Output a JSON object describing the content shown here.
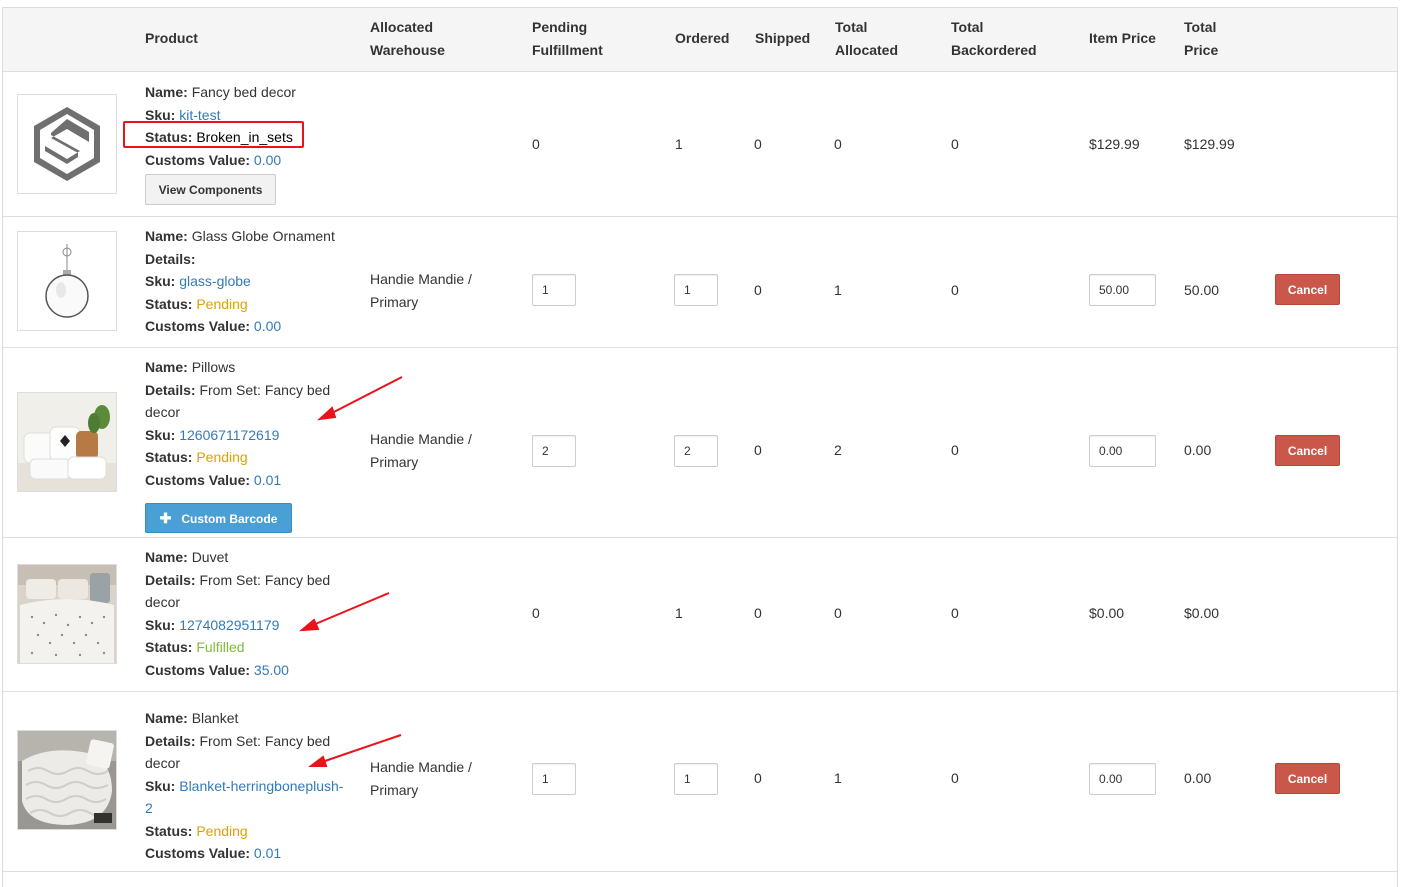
{
  "colors": {
    "link": "#337ab7",
    "pending": "#e0a000",
    "fulfilled": "#7cbb3a",
    "cancel_button": "#c9574a",
    "barcode_button": "#4a9fd5",
    "annotation_red": "#e8131b"
  },
  "headers": {
    "product": "Product",
    "warehouse_1": "Allocated",
    "warehouse_2": "Warehouse",
    "pending_1": "Pending",
    "pending_2": "Fulfillment",
    "ordered": "Ordered",
    "shipped": "Shipped",
    "total_allocated_1": "Total",
    "total_allocated_2": "Allocated",
    "total_backordered_1": "Total",
    "total_backordered_2": "Backordered",
    "item_price": "Item Price",
    "total_price_1": "Total",
    "total_price_2": "Price"
  },
  "labels": {
    "name": "Name:",
    "details": "Details:",
    "sku": "Sku:",
    "status": "Status:",
    "customs_value": "Customs Value:"
  },
  "rows": [
    {
      "name": "Fancy bed decor",
      "sku": "kit-test",
      "status": "Broken_in_sets",
      "customs_value": "0.00",
      "view_components": "View Components",
      "pending": "0",
      "ordered": "1",
      "shipped": "0",
      "total_allocated": "0",
      "total_backordered": "0",
      "item_price": "$129.99",
      "total_price": "$129.99",
      "thumb_icon": "logo-s-icon"
    },
    {
      "name": "Glass Globe Ornament",
      "details": "",
      "sku": "glass-globe",
      "status": "Pending",
      "customs_value": "0.00",
      "warehouse_1": "Handie Mandie /",
      "warehouse_2": "Primary",
      "pending": "1",
      "ordered": "1",
      "shipped": "0",
      "total_allocated": "1",
      "total_backordered": "0",
      "item_price": "50.00",
      "total_price": "50.00",
      "cancel": "Cancel",
      "thumb_icon": "ornament-icon"
    },
    {
      "name": "Pillows",
      "details_1": "From Set: Fancy bed",
      "details_2": "decor",
      "sku": "1260671172619",
      "status": "Pending",
      "customs_value": "0.01",
      "custom_barcode": "Custom Barcode",
      "warehouse_1": "Handie Mandie /",
      "warehouse_2": "Primary",
      "pending": "2",
      "ordered": "2",
      "shipped": "0",
      "total_allocated": "2",
      "total_backordered": "0",
      "item_price": "0.00",
      "total_price": "0.00",
      "cancel": "Cancel",
      "thumb_icon": "pillows-photo-icon"
    },
    {
      "name": "Duvet",
      "details_1": "From Set: Fancy bed",
      "details_2": "decor",
      "sku": "1274082951179",
      "status": "Fulfilled",
      "customs_value": "35.00",
      "pending": "0",
      "ordered": "1",
      "shipped": "0",
      "total_allocated": "0",
      "total_backordered": "0",
      "item_price": "$0.00",
      "total_price": "$0.00",
      "thumb_icon": "duvet-photo-icon"
    },
    {
      "name": "Blanket",
      "details_1": "From Set: Fancy bed",
      "details_2": "decor",
      "sku_1": "Blanket-herringboneplush-",
      "sku_2": "2",
      "status": "Pending",
      "customs_value": "0.01",
      "warehouse_1": "Handie Mandie /",
      "warehouse_2": "Primary",
      "pending": "1",
      "ordered": "1",
      "shipped": "0",
      "total_allocated": "1",
      "total_backordered": "0",
      "item_price": "0.00",
      "total_price": "0.00",
      "cancel": "Cancel",
      "thumb_icon": "blanket-photo-icon"
    }
  ]
}
